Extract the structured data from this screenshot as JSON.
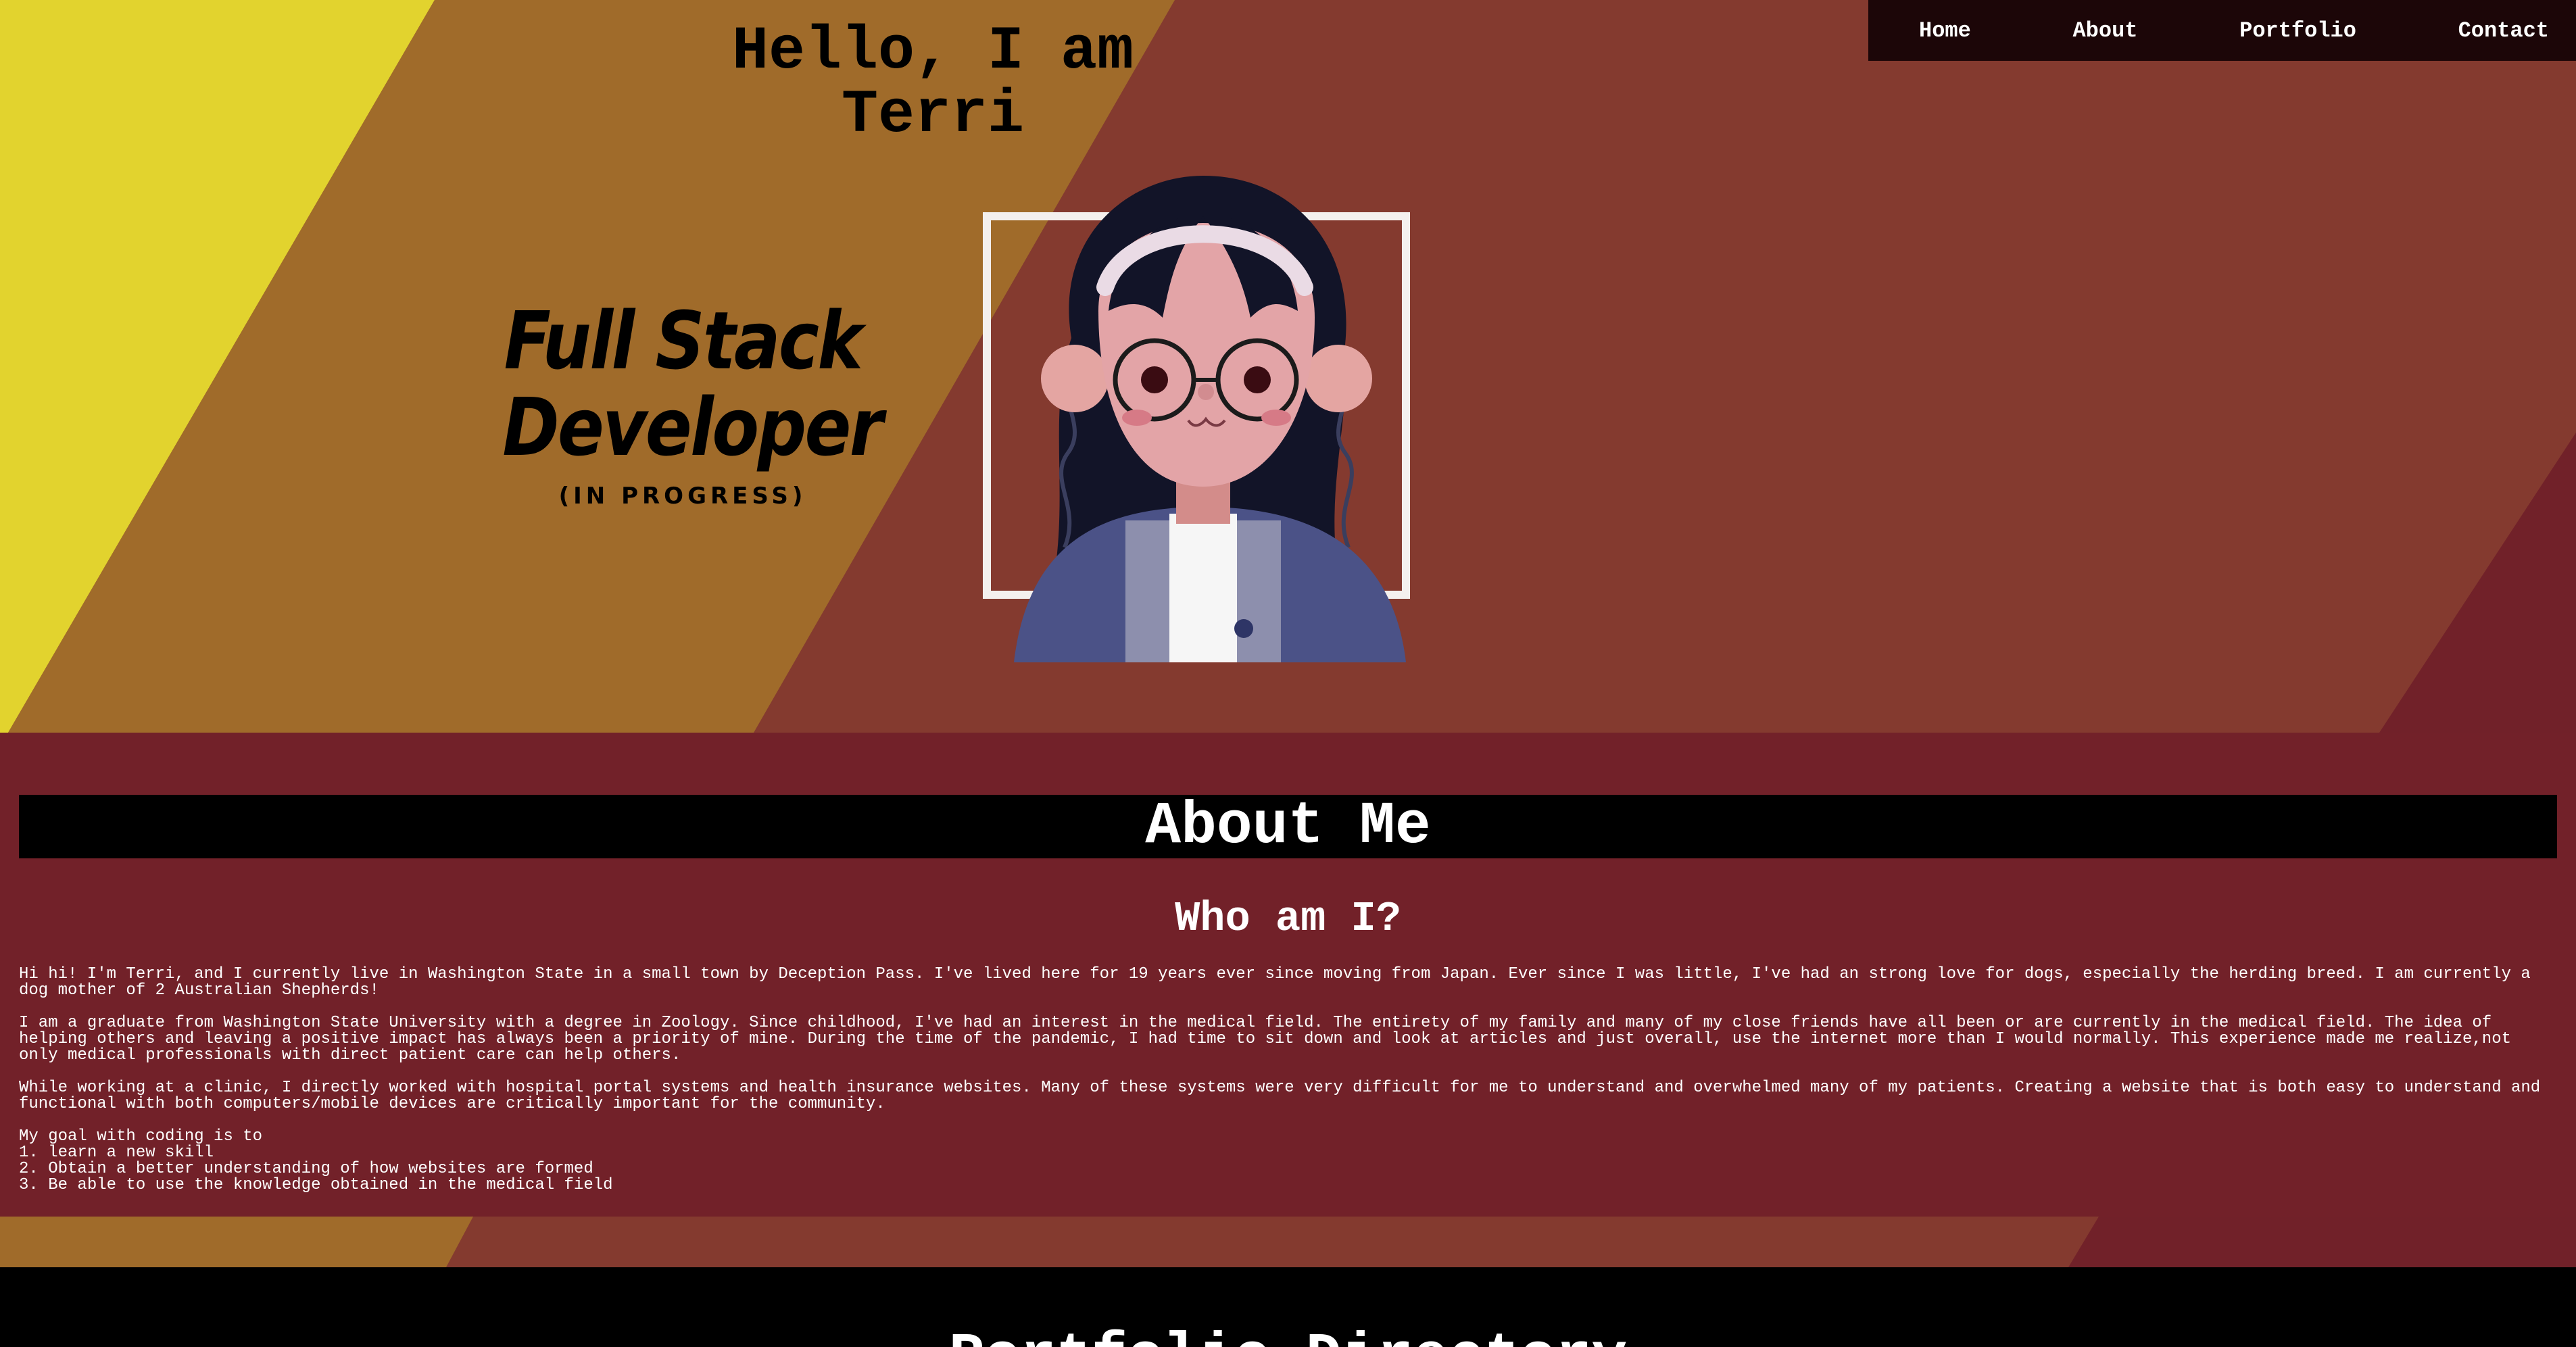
{
  "nav": {
    "items": [
      {
        "label": "Home"
      },
      {
        "label": "About"
      },
      {
        "label": "Portfolio"
      },
      {
        "label": "Contact"
      }
    ]
  },
  "hero": {
    "title_line1": "Hello, I am",
    "title_line2": "Terri",
    "tagline_line1": "Full Stack",
    "tagline_line2": "Developer",
    "tagline_sub": "(IN PROGRESS)"
  },
  "about": {
    "heading": "About Me",
    "subheading": "Who am I?",
    "paragraphs": [
      "Hi hi! I'm Terri, and I currently live in Washington State in a small town by Deception Pass. I've lived here for 19 years ever since moving from Japan. Ever since I was little, I've had an strong love for dogs, especially the herding breed. I am currently a dog mother of 2 Australian Shepherds!",
      "I am a graduate from Washington State University with a degree in Zoology. Since childhood, I've had an interest in the medical field. The entirety of my family and many of my close friends have all been or are currently in the medical field. The idea of helping others and leaving a positive impact has always been a priority of mine. During the time of the pandemic, I had time to sit down and look at articles and just overall, use the internet more than I would normally. This experience made me realize,not only medical professionals with direct patient care can help others.",
      "While working at a clinic, I directly worked with hospital portal systems and health insurance websites. Many of these systems were very difficult for me to understand and overwhelmed many of my patients. Creating a website that is both easy to understand and functional with both computers/mobile devices are critically important for the community."
    ],
    "goal_intro": "My goal with coding is to",
    "goals": [
      "1. learn a new skill",
      "2. Obtain a better understanding of how websites are formed",
      "3. Be able to use the knowledge obtained in the medical field"
    ]
  },
  "portfolio": {
    "heading": "Portfolio Directory"
  },
  "colors": {
    "hero_maroon": "#843a2f",
    "stripe_yellow": "#e2d32e",
    "stripe_gold": "#a06b2a",
    "about_bg": "#722129",
    "nav_bg": "#1c0608"
  }
}
